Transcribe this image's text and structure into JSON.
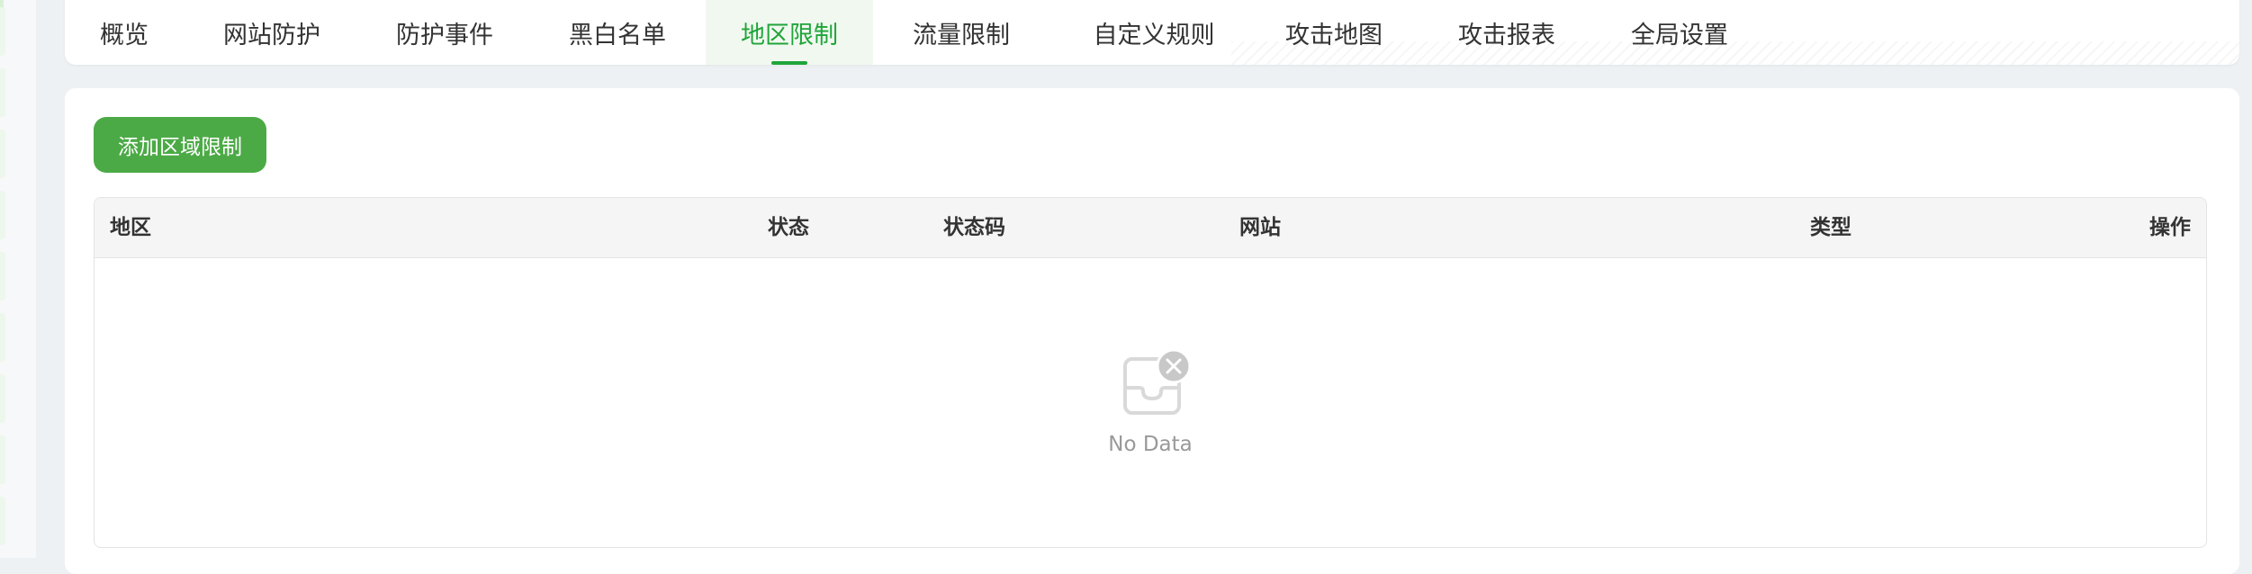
{
  "nav": {
    "tabs": [
      {
        "label": "概览",
        "active": false
      },
      {
        "label": "网站防护",
        "active": false
      },
      {
        "label": "防护事件",
        "active": false
      },
      {
        "label": "黑白名单",
        "active": false
      },
      {
        "label": "地区限制",
        "active": true
      },
      {
        "label": "流量限制",
        "active": false
      },
      {
        "label": "自定义规则",
        "active": false
      },
      {
        "label": "攻击地图",
        "active": false
      },
      {
        "label": "攻击报表",
        "active": false
      },
      {
        "label": "全局设置",
        "active": false
      }
    ]
  },
  "toolbar": {
    "add_label": "添加区域限制"
  },
  "table": {
    "columns": [
      "地区",
      "状态",
      "状态码",
      "网站",
      "类型",
      "操作"
    ],
    "rows": [],
    "empty_text": "No Data",
    "empty_icon": "empty-inbox-icon"
  },
  "colors": {
    "accent": "#20a53a",
    "button": "#4caa46",
    "active_tab_bg": "#f1f8f0",
    "page_bg": "#eef1f3"
  }
}
